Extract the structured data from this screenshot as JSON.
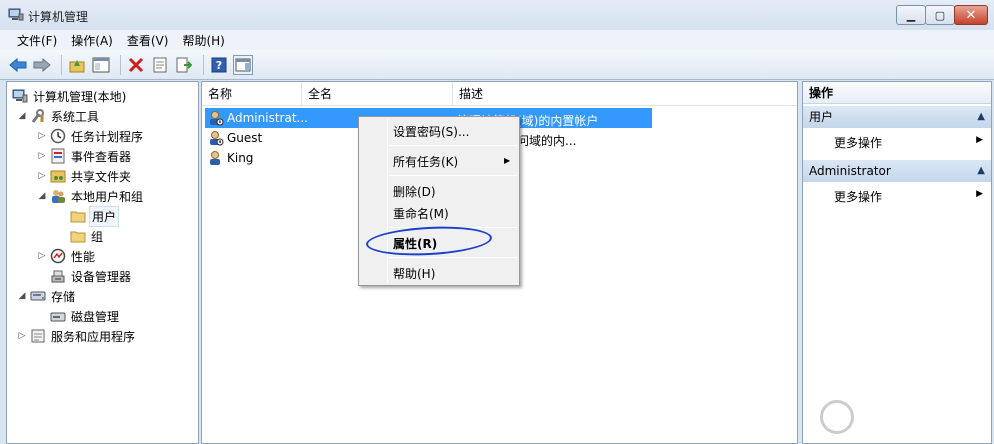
{
  "window": {
    "title": "计算机管理"
  },
  "menu": [
    "文件(F)",
    "操作(A)",
    "查看(V)",
    "帮助(H)"
  ],
  "tree": [
    {
      "label": "计算机管理(本地)",
      "icon": "computer-manage-icon",
      "expander": ""
    },
    {
      "label": "系统工具",
      "icon": "tools-icon",
      "expander": "◢"
    },
    {
      "label": "任务计划程序",
      "icon": "clock-icon",
      "expander": "▷"
    },
    {
      "label": "事件查看器",
      "icon": "event-viewer-icon",
      "expander": "▷"
    },
    {
      "label": "共享文件夹",
      "icon": "shared-folder-icon",
      "expander": "▷"
    },
    {
      "label": "本地用户和组",
      "icon": "users-group-icon",
      "expander": "◢"
    },
    {
      "label": "用户",
      "icon": "folder-icon",
      "expander": ""
    },
    {
      "label": "组",
      "icon": "folder-icon",
      "expander": ""
    },
    {
      "label": "性能",
      "icon": "performance-icon",
      "expander": "▷"
    },
    {
      "label": "设备管理器",
      "icon": "device-manager-icon",
      "expander": ""
    },
    {
      "label": "存储",
      "icon": "storage-icon",
      "expander": "◢"
    },
    {
      "label": "磁盘管理",
      "icon": "disk-icon",
      "expander": ""
    },
    {
      "label": "服务和应用程序",
      "icon": "services-icon",
      "expander": "▷"
    }
  ],
  "list": {
    "columns": [
      "名称",
      "全名",
      "描述"
    ],
    "rows": [
      {
        "name": "Administrat...",
        "description": "管理计算机(域)的内置帐户"
      },
      {
        "name": "Guest",
        "description": "计算机或访问域的内..."
      },
      {
        "name": "King",
        "description": ""
      }
    ]
  },
  "context_menu": {
    "items": [
      "设置密码(S)...",
      "所有任务(K)",
      "删除(D)",
      "重命名(M)",
      "属性(R)",
      "帮助(H)"
    ]
  },
  "actions": {
    "title": "操作",
    "groups": [
      {
        "label": "用户",
        "more": "更多操作"
      },
      {
        "label": "Administrator",
        "more": "更多操作"
      }
    ]
  },
  "colors": {
    "selection": "#3399ff",
    "annotation_circle": "#1a3fc9"
  }
}
